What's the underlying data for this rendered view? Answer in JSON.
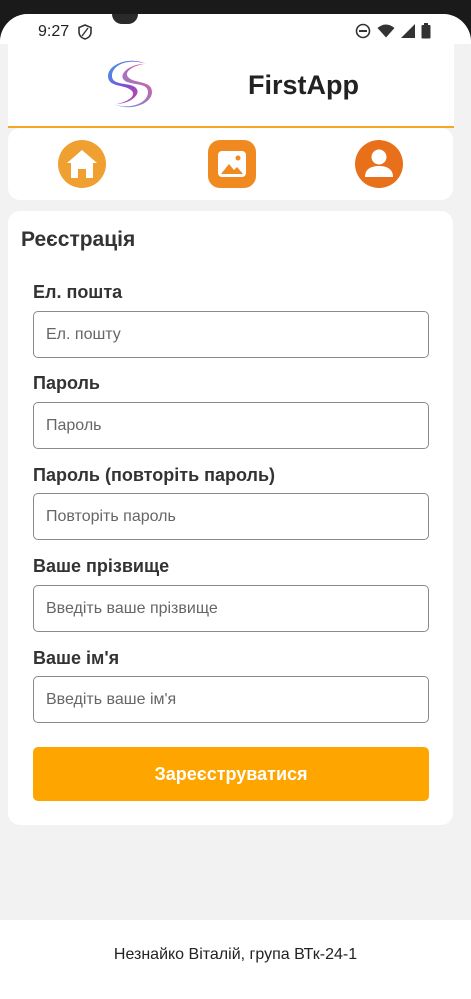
{
  "status_bar": {
    "time": "9:27"
  },
  "header": {
    "app_title": "FirstApp"
  },
  "nav": {
    "items": [
      {
        "icon": "home-icon",
        "color": "#f0a030"
      },
      {
        "icon": "image-icon",
        "color": "#f08a20"
      },
      {
        "icon": "user-icon",
        "color": "#e8701a"
      }
    ]
  },
  "form": {
    "title": "Реєстрація",
    "fields": [
      {
        "label": "Ел. пошта",
        "placeholder": "Ел. пошту",
        "value": ""
      },
      {
        "label": "Пароль",
        "placeholder": "Пароль",
        "value": ""
      },
      {
        "label": "Пароль (повторіть пароль)",
        "placeholder": "Повторіть пароль",
        "value": ""
      },
      {
        "label": "Ваше прізвище",
        "placeholder": "Введіть ваше прізвище",
        "value": ""
      },
      {
        "label": "Ваше ім'я",
        "placeholder": "Введіть ваше ім'я",
        "value": ""
      }
    ],
    "submit_label": "Зареєструватися"
  },
  "footer": {
    "text": "Незнайко Віталій, група ВТк-24-1"
  },
  "colors": {
    "accent": "#ffa500",
    "header_border": "#f5a623",
    "background": "#f2f2f2"
  }
}
